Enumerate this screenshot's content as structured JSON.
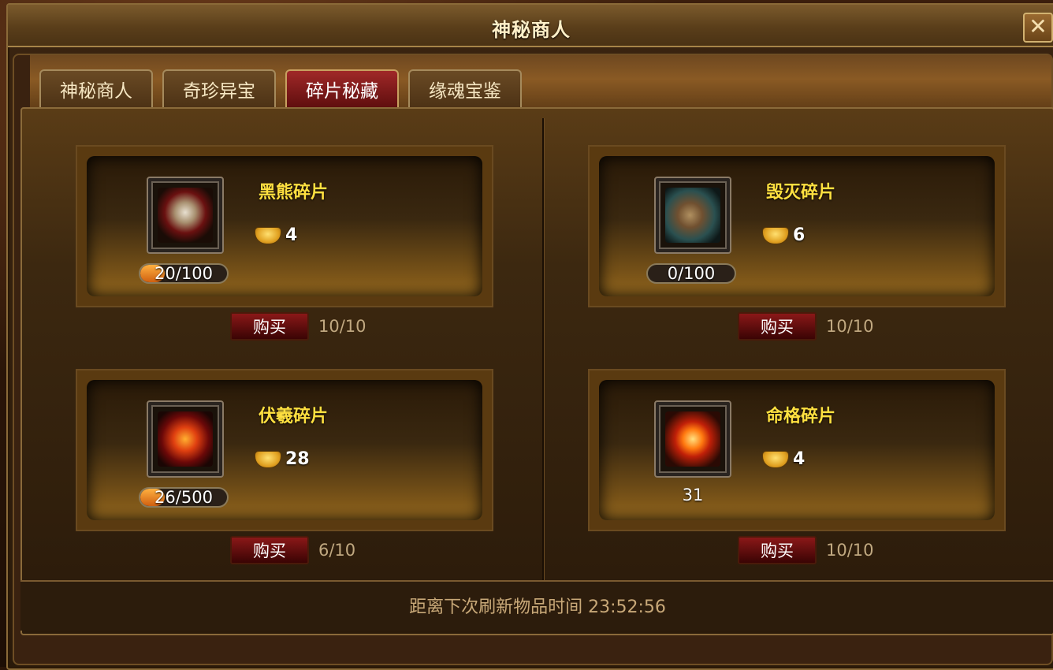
{
  "window": {
    "title": "神秘商人",
    "close_icon": "close-icon"
  },
  "tabs": [
    {
      "label": "神秘商人",
      "active": false
    },
    {
      "label": "奇珍异宝",
      "active": false
    },
    {
      "label": "碎片秘藏",
      "active": true
    },
    {
      "label": "缘魂宝鉴",
      "active": false
    }
  ],
  "items": [
    {
      "name": "黑熊碎片",
      "price": "4",
      "progress_text": "20/100",
      "progress": 0.2,
      "buy_label": "购买",
      "limit": "10/10",
      "icon": "bear-mask-icon"
    },
    {
      "name": "毁灭碎片",
      "price": "6",
      "progress_text": "0/100",
      "progress": 0.0,
      "buy_label": "购买",
      "limit": "10/10",
      "icon": "bell-icon"
    },
    {
      "name": "伏羲碎片",
      "price": "28",
      "progress_text": "26/500",
      "progress": 0.052,
      "buy_label": "购买",
      "limit": "6/10",
      "icon": "fuxi-armor-icon"
    },
    {
      "name": "命格碎片",
      "price": "4",
      "count_text": "31",
      "buy_label": "购买",
      "limit": "10/10",
      "icon": "flame-swirl-icon"
    }
  ],
  "currency_icon": "gold-ingot-icon",
  "footer": {
    "refresh_text": "距离下次刷新物品时间  23:52:56"
  }
}
